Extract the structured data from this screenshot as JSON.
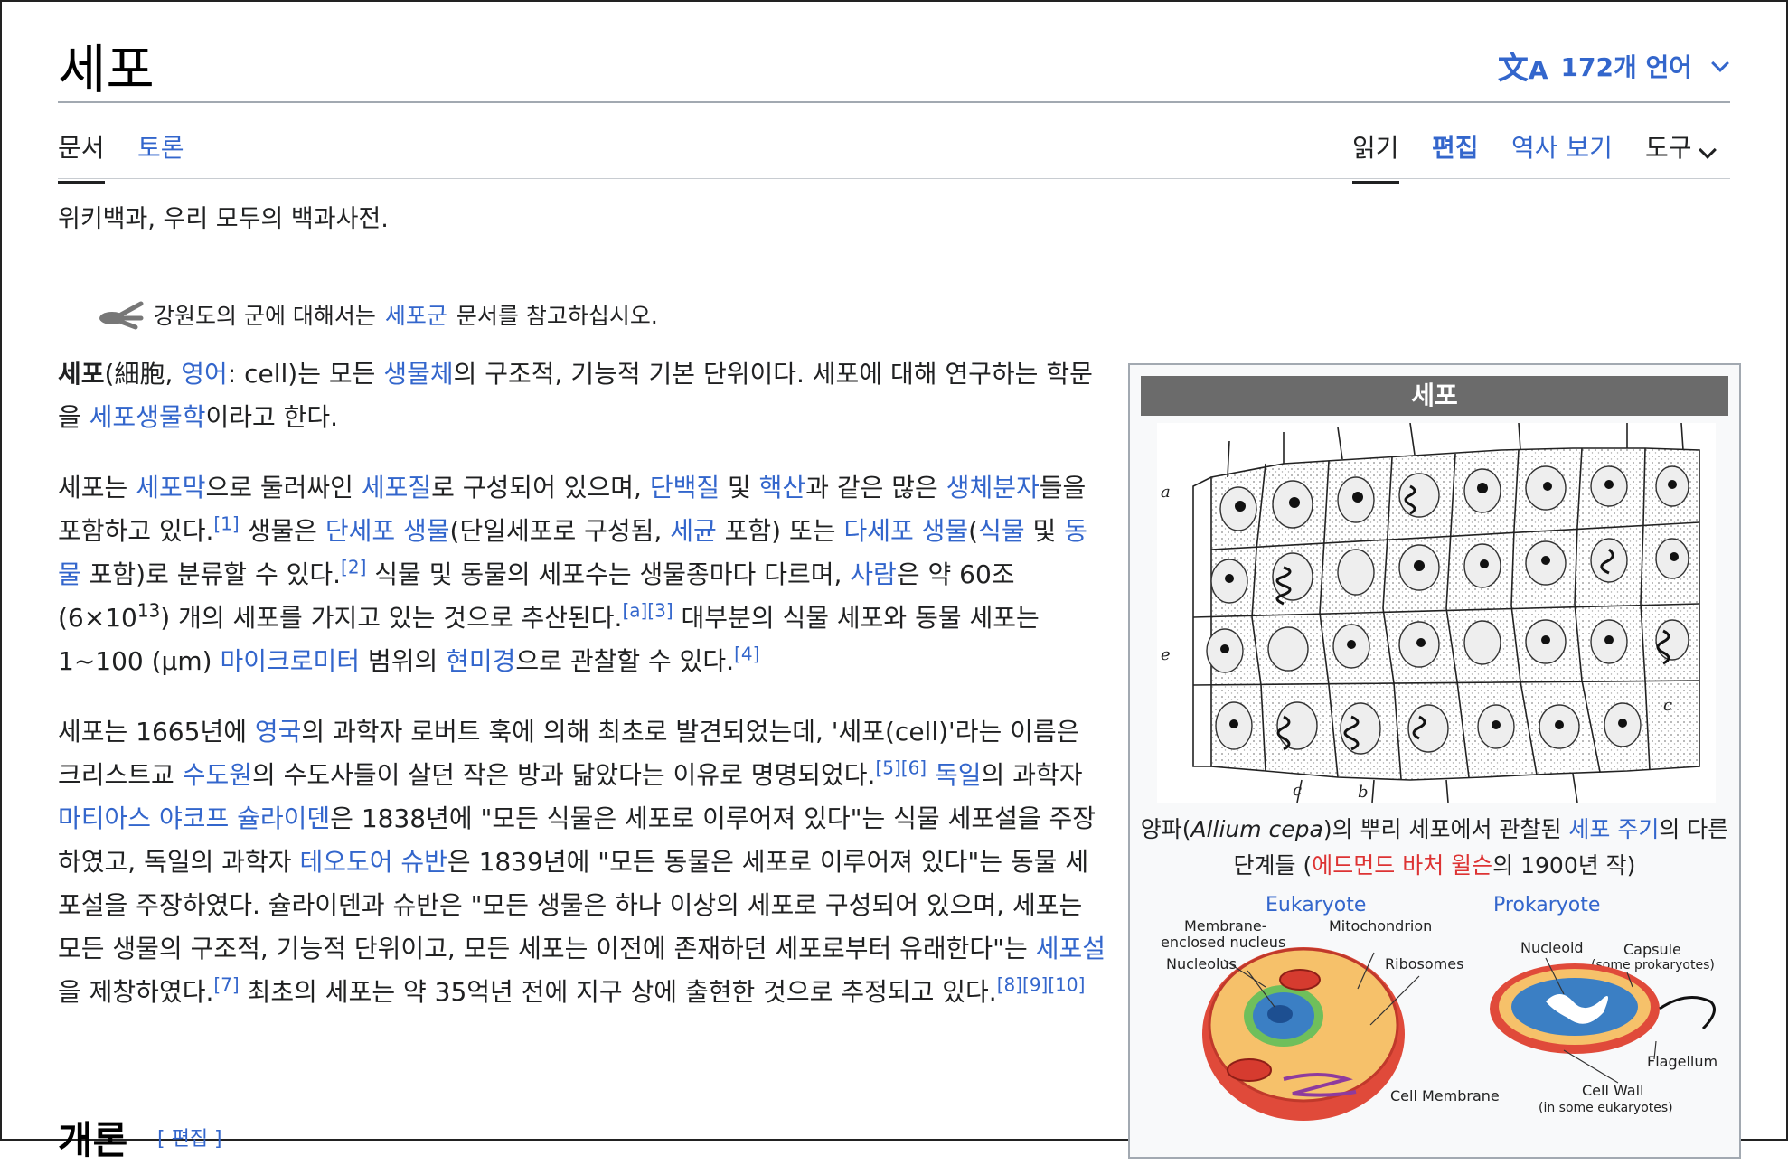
{
  "title": "세포",
  "language_button": "172개 언어",
  "tabs": {
    "article": "문서",
    "talk": "토론",
    "read": "읽기",
    "edit": "편집",
    "history": "역사 보기",
    "tools": "도구"
  },
  "tagline": "위키백과, 우리 모두의 백과사전.",
  "hatnote": {
    "before": "강원도의 군에 대해서는 ",
    "link": "세포군",
    "after": " 문서를 참고하십시오."
  },
  "infobox": {
    "header": "세포",
    "caption1": {
      "a": "양파(",
      "b": "Allium cepa",
      "c": ")의 뿌리 세포에서 관찰된 ",
      "d": "세포 주기",
      "e": "의 다른",
      "f": "단계들 (",
      "g": "에드먼드 바처 윌슨",
      "h": "의 1900년 작)"
    },
    "micro_labels": {
      "a": "a",
      "b": "b",
      "c1": "c",
      "c2": "c",
      "e": "e"
    },
    "diagram": {
      "eukaryote": "Eukaryote",
      "prokaryote": "Prokaryote",
      "membrane1": "Membrane-",
      "membrane2": "enclosed nucleus",
      "nucleolus": "Nucleolus",
      "mitochondrion": "Mitochondrion",
      "ribosomes": "Ribosomes",
      "nucleoid": "Nucleoid",
      "capsule": "Capsule",
      "capsule_note": "(some prokaryotes)",
      "flagellum": "Flagellum",
      "cell_membrane": "Cell Membrane",
      "cell_wall": "Cell Wall",
      "cell_wall_note": "(in some eukaryotes)"
    }
  },
  "section": {
    "heading": "개론",
    "edit": "[ 편집 ]"
  },
  "p1": {
    "a": "세포",
    "b": "(細胞, ",
    "c": "영어",
    "d": ": cell)는 모든 ",
    "e": "생물체",
    "f": "의 구조적, 기능적 기본 단위이다. 세포에 대해 연구하는 학문을 ",
    "g": "세포생물학",
    "h": "이라고 한다."
  },
  "p2": {
    "a": "세포는 ",
    "b": "세포막",
    "c": "으로 둘러싸인 ",
    "d": "세포질",
    "e": "로 구성되어 있으며, ",
    "f": "단백질",
    "g": " 및 ",
    "h": "핵산",
    "i": "과 같은 많은 ",
    "j": "생체분자",
    "k": "들을 포함하고 있다.",
    "ref1": "[1]",
    "l": " 생물은 ",
    "m": "단세포 생물",
    "n": "(단일세포로 구성됨, ",
    "o": "세균",
    "p": " 포함) 또는 ",
    "q": "다세포 생물",
    "r": "(",
    "s": "식물",
    "t": " 및 ",
    "u": "동물",
    "v": " 포함)로 분류할 수 있다.",
    "ref2": "[2]",
    "w": " 식물 및 동물의 세포수는 생물종마다 다르며, ",
    "x": "사람",
    "y": "은 약 60조 (6×10",
    "exp": "13",
    "z": ") 개의 세포를 가지고 있는 것으로 추산된다.",
    "ref3": "[a][3]",
    "aa": " 대부분의 식물 세포와 동물 세포는 1~100 (µm) ",
    "bb": "마이크로미터",
    "cc": " 범위의 ",
    "dd": "현미경",
    "ee": "으로 관찰할 수 있다.",
    "ref4": "[4]"
  },
  "p3": {
    "a": "세포는 1665년에 ",
    "b": "영국",
    "c": "의 과학자 로버트 훅에 의해 최초로 발견되었는데, '세포(cell)'라는 이름은 크리스트교 ",
    "d": "수도원",
    "e": "의 수도사들이 살던 작은 방과 닮았다는 이유로 명명되었다.",
    "ref56": "[5][6]",
    "f": " ",
    "g": "독일",
    "h": "의 과학자 ",
    "i": "마티아스 야코프 슐라이덴",
    "j": "은 1838년에 \"모든 식물은 세포로 이루어져 있다\"는 식물 세포설을 주장하였고, 독일의 과학자 ",
    "k": "테오도어 슈반",
    "l": "은 1839년에 \"모든 동물은 세포로 이루어져 있다\"는 동물 세포설을 주장하였다. 슐라이덴과 슈반은 \"모든 생물은 하나 이상의 세포로 구성되어 있으며, 세포는 모든 생물의 구조적, 기능적 단위이고, 모든 세포는 이전에 존재하던 세포로부터 유래한다\"는 ",
    "m": "세포설",
    "n": "을 제창하였다.",
    "ref7": "[7]",
    "o": " 최초의 세포는 약 35억년 전에 지구 상에 출현한 것으로 추정되고 있다.",
    "ref810": "[8][9][10]"
  }
}
